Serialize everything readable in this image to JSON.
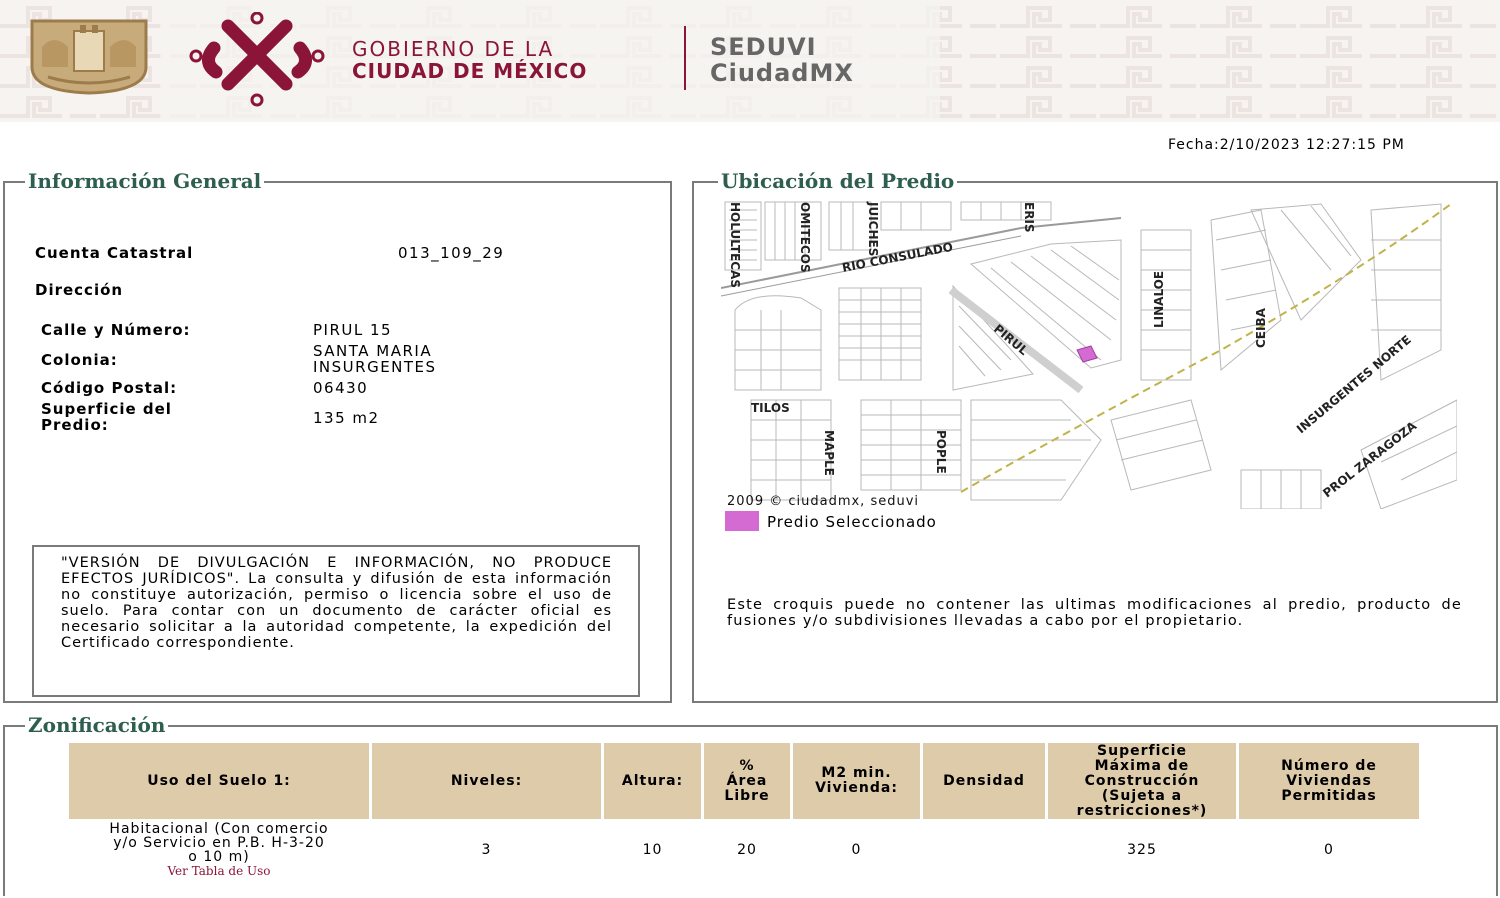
{
  "header": {
    "gobierno_line1": "GOBIERNO DE LA",
    "gobierno_line2": "CIUDAD DE MÉXICO",
    "seduvi_line1": "SEDUVI",
    "seduvi_line2": "CiudadMX",
    "brand_color": "#8a1538"
  },
  "fecha": "Fecha:2/10/2023 12:27:15 PM",
  "informacion_general": {
    "title": "Información General",
    "cuenta_label": "Cuenta Catastral",
    "cuenta_value": "013_109_29",
    "direccion_label": "Dirección",
    "calle_label": "Calle y Número:",
    "calle_value": "PIRUL 15",
    "colonia_label": "Colonia:",
    "colonia_value_1": "SANTA MARIA",
    "colonia_value_2": "INSURGENTES",
    "cp_label": "Código Postal:",
    "cp_value": "06430",
    "superficie_label_1": "Superficie del",
    "superficie_label_2": "Predio:",
    "superficie_value": "135 m2",
    "disclaimer": "\"VERSIÓN DE DIVULGACIÓN E INFORMACIÓN, NO PRODUCE EFECTOS JURÍDICOS\". La consulta y difusión de esta información no constituye autorización, permiso o licencia sobre el uso de suelo. Para contar con un documento de carácter oficial es necesario solicitar a la autoridad competente, la expedición del Certificado correspondiente."
  },
  "ubicacion": {
    "title": "Ubicación del Predio",
    "map_labels": {
      "holultecas": "HOLULTECAS",
      "omitecos": "OMITECOS",
      "huichres": "JUICHES",
      "eris": "ERIS",
      "rio_consulado": "RIO CONSULADO",
      "pirul": "PIRUL",
      "linaloe": "LINALOE",
      "ceiba": "CEIBA",
      "insurgentes": "INSURGENTES NORTE",
      "tilos": "TILOS",
      "maple": "MAPLE",
      "pople": "POPLE",
      "prol_zaragoza": "PROL ZARAGOZA",
      "copyright": "2009 © ciudadmx, seduvi"
    },
    "predio_label": "Predio Seleccionado",
    "predio_color": "#d36bd3",
    "croquis_note": "Este croquis puede no contener las ultimas modificaciones al predio, producto de fusiones y/o subdivisiones llevadas a cabo por el propietario."
  },
  "zonificacion": {
    "title": "Zonificación",
    "headers": {
      "uso": "Uso del Suelo 1:",
      "niveles": "Niveles:",
      "altura": "Altura:",
      "area_libre_1": "%",
      "area_libre_2": "Área",
      "area_libre_3": "Libre",
      "m2min_1": "M2 min.",
      "m2min_2": "Vivienda:",
      "densidad": "Densidad",
      "superficie_1": "Superficie",
      "superficie_2": "Máxima de",
      "superficie_3": "Construcción",
      "superficie_4": "(Sujeta a",
      "superficie_5": "restricciones*)",
      "numero_1": "Número de",
      "numero_2": "Viviendas",
      "numero_3": "Permitidas"
    },
    "row": {
      "uso_1": "Habitacional (Con comercio",
      "uso_2": "y/o Servicio en P.B. H-3-20",
      "uso_3": "o 10 m)",
      "uso_link": "Ver Tabla de Uso",
      "niveles": "3",
      "altura": "10",
      "area_libre": "20",
      "m2min": "0",
      "densidad": "",
      "superficie": "325",
      "numero": "0"
    },
    "header_bg": "#decbaa"
  }
}
